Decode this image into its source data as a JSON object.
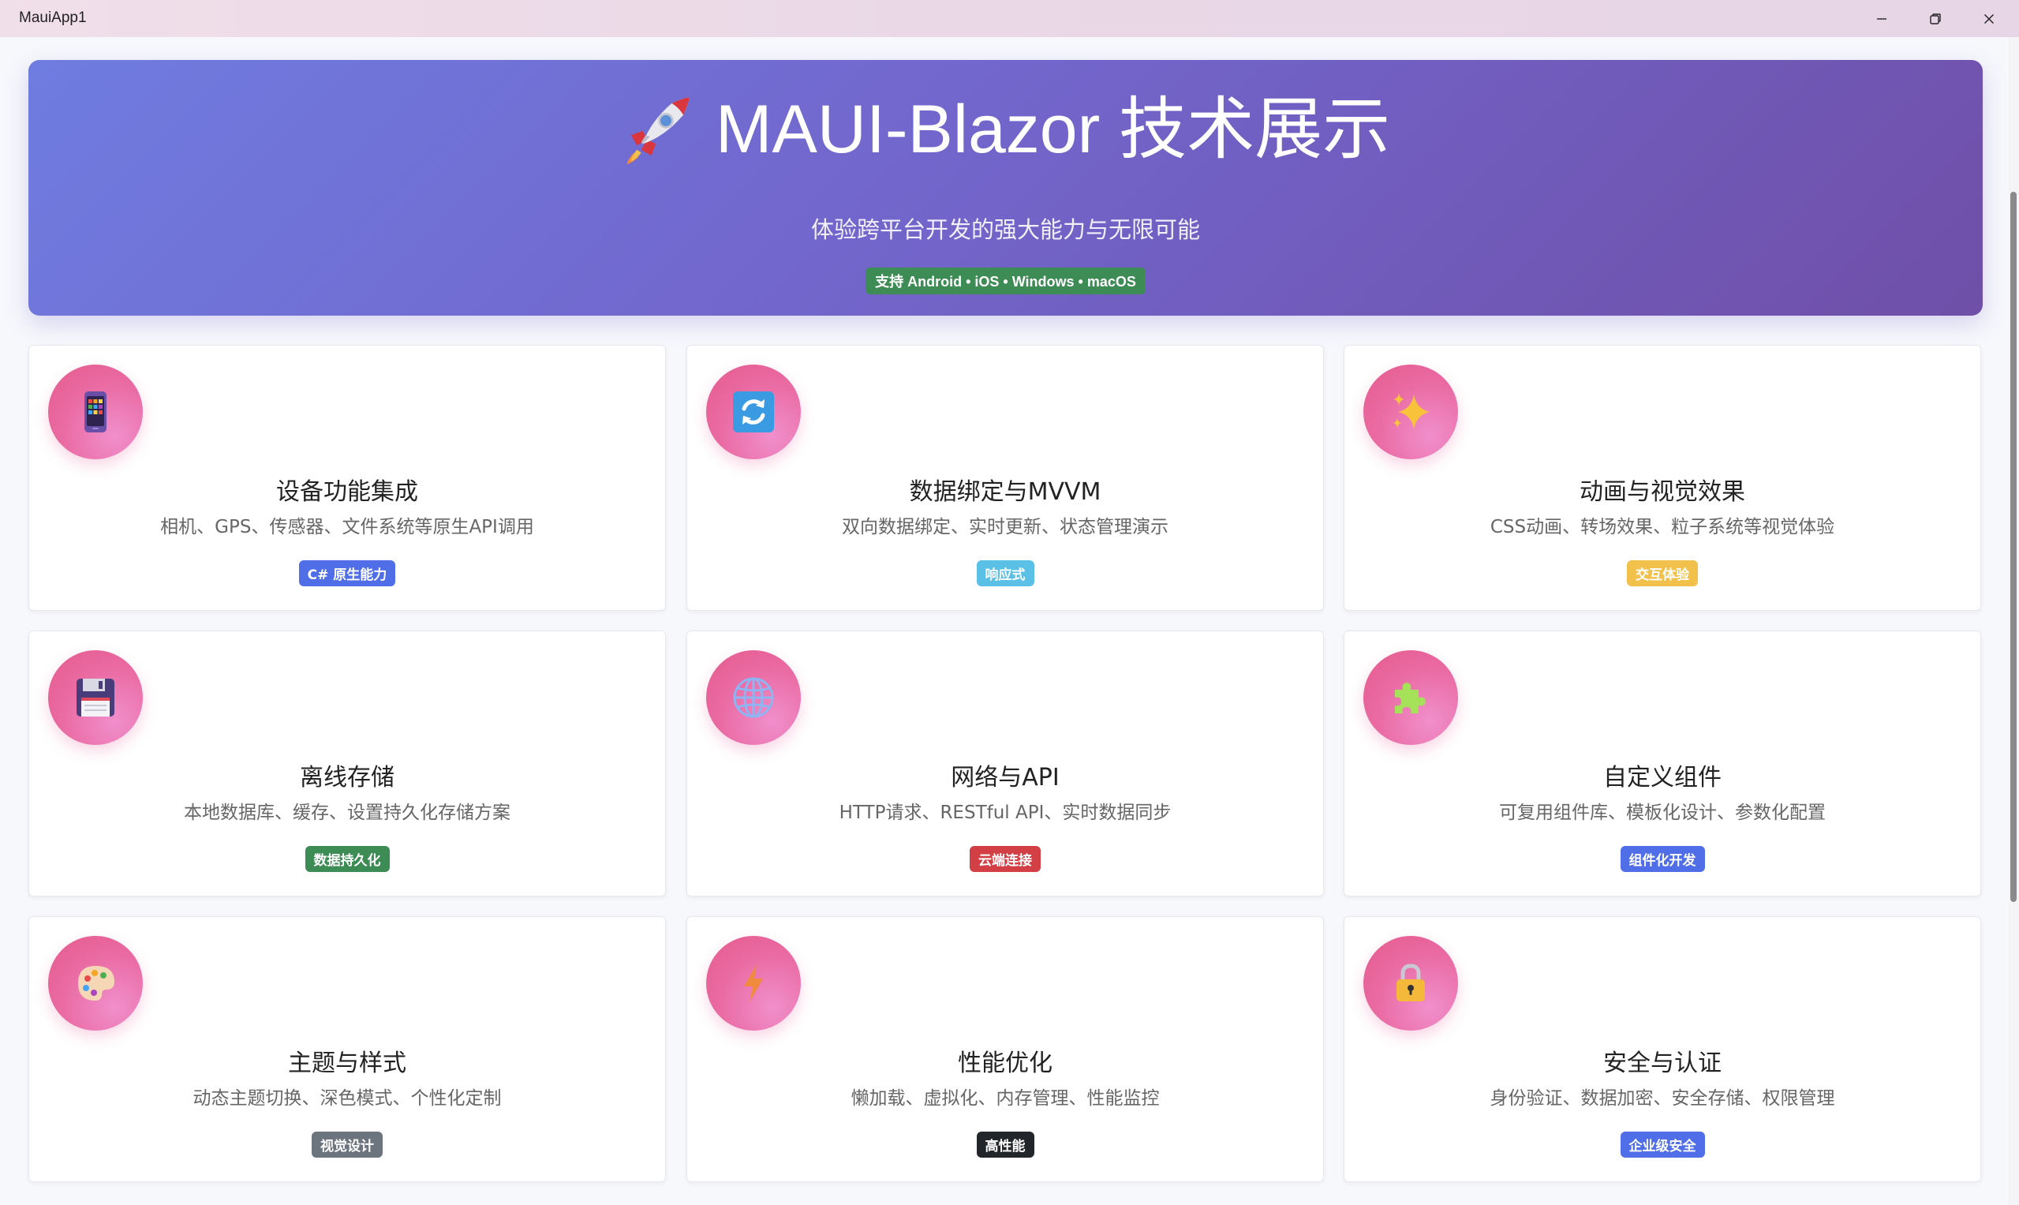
{
  "window": {
    "title": "MauiApp1",
    "controls": [
      "minimize",
      "restore",
      "close"
    ]
  },
  "hero": {
    "icon": "rocket-icon",
    "title": "MAUI-Blazor 技术展示",
    "subtitle": "体验跨平台开发的强大能力与无限可能",
    "badge": "支持 Android • iOS • Windows • macOS",
    "badge_color": "#3d8b55"
  },
  "cards": [
    {
      "icon": "mobile-app-icon",
      "title": "设备功能集成",
      "desc": "相机、GPS、传感器、文件系统等原生API调用",
      "badge": "C# 原生能力",
      "badge_bg": "#4f6ee8",
      "badge_fg": "#ffffff"
    },
    {
      "icon": "sync-icon",
      "title": "数据绑定与MVVM",
      "desc": "双向数据绑定、实时更新、状态管理演示",
      "badge": "响应式",
      "badge_bg": "#5bc0e6",
      "badge_fg": "#ffffff"
    },
    {
      "icon": "sparkles-icon",
      "title": "动画与视觉效果",
      "desc": "CSS动画、转场效果、粒子系统等视觉体验",
      "badge": "交互体验",
      "badge_bg": "#f2c14b",
      "badge_fg": "#ffffff"
    },
    {
      "icon": "floppy-disk-icon",
      "title": "离线存储",
      "desc": "本地数据库、缓存、设置持久化存储方案",
      "badge": "数据持久化",
      "badge_bg": "#3d8b55",
      "badge_fg": "#ffffff"
    },
    {
      "icon": "globe-icon",
      "title": "网络与API",
      "desc": "HTTP请求、RESTful API、实时数据同步",
      "badge": "云端连接",
      "badge_bg": "#d23f45",
      "badge_fg": "#ffffff"
    },
    {
      "icon": "puzzle-piece-icon",
      "title": "自定义组件",
      "desc": "可复用组件库、模板化设计、参数化配置",
      "badge": "组件化开发",
      "badge_bg": "#4f6ee8",
      "badge_fg": "#ffffff"
    },
    {
      "icon": "palette-icon",
      "title": "主题与样式",
      "desc": "动态主题切换、深色模式、个性化定制",
      "badge": "视觉设计",
      "badge_bg": "#6c757d",
      "badge_fg": "#ffffff"
    },
    {
      "icon": "lightning-icon",
      "title": "性能优化",
      "desc": "懒加载、虚拟化、内存管理、性能监控",
      "badge": "高性能",
      "badge_bg": "#222529",
      "badge_fg": "#ffffff"
    },
    {
      "icon": "lock-icon",
      "title": "安全与认证",
      "desc": "身份验证、数据加密、安全存储、权限管理",
      "badge": "企业级安全",
      "badge_bg": "#4f6ee8",
      "badge_fg": "#ffffff"
    }
  ]
}
